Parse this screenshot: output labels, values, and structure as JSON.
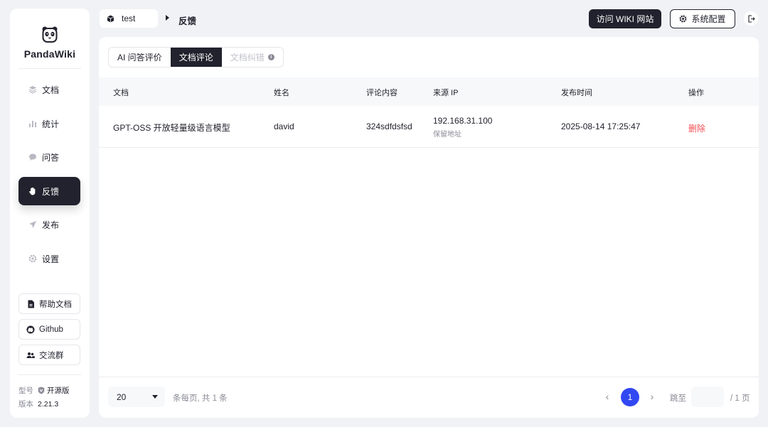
{
  "app": {
    "name": "PandaWiki"
  },
  "sidebar": {
    "items": [
      {
        "label": "文档",
        "icon": "doc-stack-icon"
      },
      {
        "label": "统计",
        "icon": "bar-chart-icon"
      },
      {
        "label": "问答",
        "icon": "chat-bubble-icon"
      },
      {
        "label": "反馈",
        "icon": "hand-icon",
        "active": true
      },
      {
        "label": "发布",
        "icon": "send-icon"
      },
      {
        "label": "设置",
        "icon": "gear-icon"
      }
    ],
    "help_doc": "帮助文档",
    "github": "Github",
    "community": "交流群",
    "edition_label": "型号",
    "edition_value": "开源版",
    "version_label": "版本",
    "version_value": "2.21.3"
  },
  "topbar": {
    "kb_name": "test",
    "current_page": "反馈",
    "visit_wiki": "访问 WIKI 网站",
    "system_config": "系统配置"
  },
  "tabs": [
    {
      "label": "AI 问答评价"
    },
    {
      "label": "文档评论",
      "active": true
    },
    {
      "label": "文档纠错",
      "disabled": true
    }
  ],
  "table": {
    "columns": [
      "文档",
      "姓名",
      "评论内容",
      "来源 IP",
      "发布时间",
      "操作"
    ],
    "rows": [
      {
        "doc": "GPT-OSS 开放轻量级语言模型",
        "name": "david",
        "content": "324sdfdsfsd",
        "ip": "192.168.31.100",
        "ip_note": "保留地址",
        "time": "2025-08-14 17:25:47",
        "action": "删除"
      }
    ]
  },
  "pagination": {
    "page_size": "20",
    "info": "条每页, 共 1 条",
    "current_page": "1",
    "jump_label": "跳至",
    "total_pages": "/ 1 页"
  },
  "colors": {
    "primary_dark": "#21222d",
    "page_bg": "#f1f2f6",
    "accent_blue": "#3248f2",
    "danger": "#f64e54"
  }
}
